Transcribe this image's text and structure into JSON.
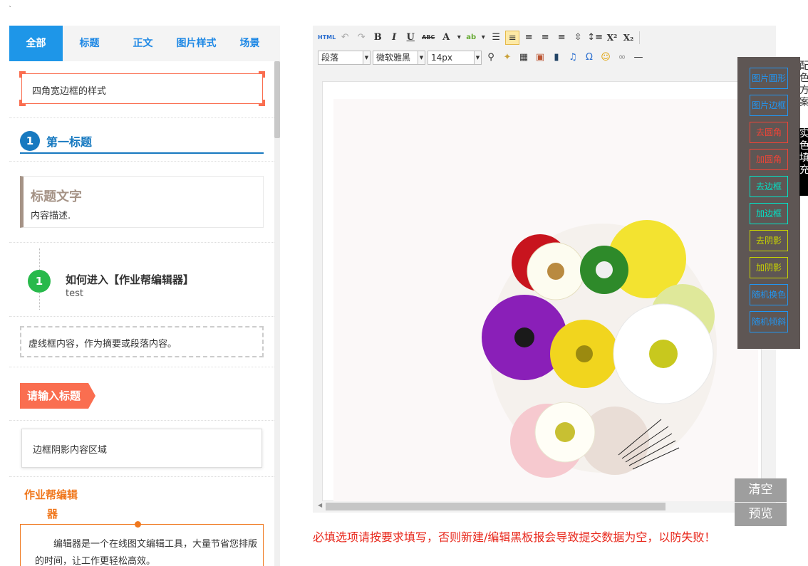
{
  "tick": "`",
  "tabs": [
    "全部",
    "标题",
    "正文",
    "图片样式",
    "场景"
  ],
  "styles": {
    "corner_box": "四角宽边框的样式",
    "numbered_title": {
      "num": "1",
      "text": "第一标题"
    },
    "left_border_title": {
      "title": "标题文字",
      "desc": "内容描述."
    },
    "timeline": {
      "num": "1",
      "title": "如何进入【作业帮编辑器】",
      "sub": "test"
    },
    "dashed_box": "虚线框内容，作为摘要或段落内容。",
    "arrow_title": "请输入标题",
    "shadow_box": "边框阴影内容区域",
    "orange_box": {
      "title_line1": "作业帮编辑",
      "title_line2": "器",
      "text": "编辑器是一个在线图文编辑工具，大量节省您排版的时间，让工作更轻松高效。"
    }
  },
  "toolbar": {
    "html": "HTML",
    "undo": "↶",
    "redo": "↷",
    "bold": "B",
    "italic": "I",
    "underline": "U",
    "strike": "ABC",
    "font_color": "A",
    "highlight": "ab",
    "paragraph": "段落",
    "font_family": "微软雅黑",
    "font_size": "14px",
    "superscript": "X²",
    "subscript": "X₂",
    "omega": "Ω"
  },
  "float_panel": {
    "buttons": [
      {
        "label": "图片圆形",
        "color": "#2196f3"
      },
      {
        "label": "图片边框",
        "color": "#2196f3"
      },
      {
        "label": "去圆角",
        "color": "#f44336"
      },
      {
        "label": "加圆角",
        "color": "#f44336"
      },
      {
        "label": "去边框",
        "color": "#00e5c8"
      },
      {
        "label": "加边框",
        "color": "#00e5c8"
      },
      {
        "label": "去阴影",
        "color": "#c8d400"
      },
      {
        "label": "加阴影",
        "color": "#c8d400"
      },
      {
        "label": "随机换色",
        "color": "#2196f3"
      },
      {
        "label": "随机倾斜",
        "color": "#2196f3"
      }
    ]
  },
  "side_text": "配色方案",
  "side_black": "实色填充",
  "actions": {
    "clear": "清空",
    "preview": "预览"
  },
  "warning": "必填选项请按要求填写，否则新建/编辑黑板报会导致提交数据为空，以防失败！"
}
